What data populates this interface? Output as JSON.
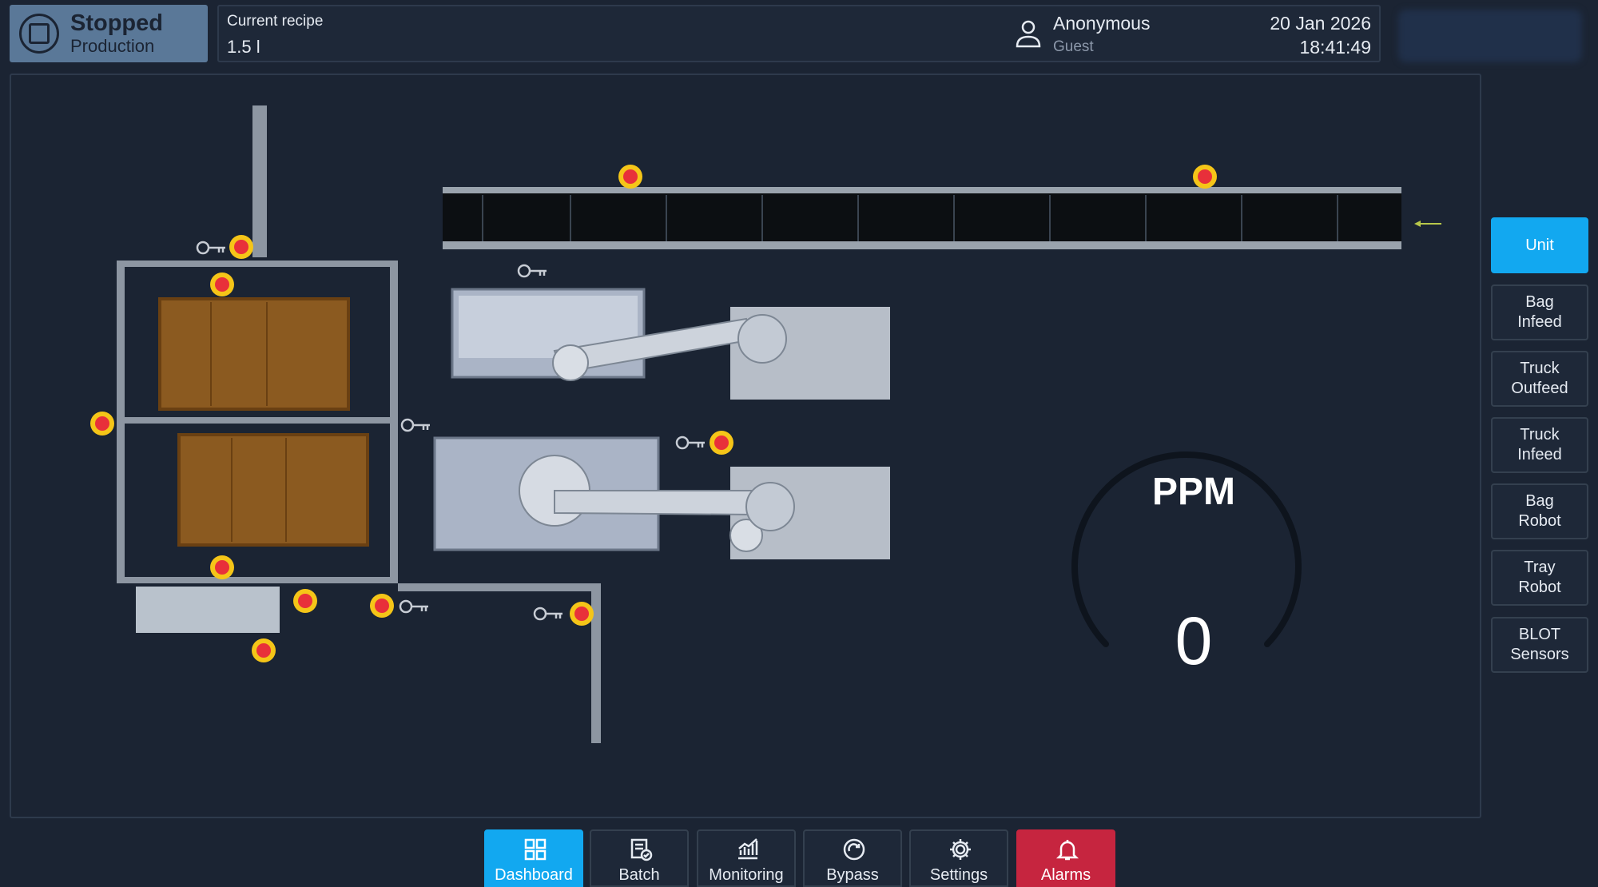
{
  "status": {
    "title": "Stopped",
    "subtitle": "Production"
  },
  "recipe": {
    "label": "Current recipe",
    "value": "1.5 l"
  },
  "user": {
    "name": "Anonymous",
    "role": "Guest",
    "icon": "user-icon"
  },
  "datetime": {
    "date": "20 Jan 2026",
    "time": "18:41:49"
  },
  "gauge": {
    "label": "PPM",
    "value": "0"
  },
  "side_nav": [
    {
      "label": "Unit",
      "active": true
    },
    {
      "label": "Bag\nInfeed",
      "active": false
    },
    {
      "label": "Truck\nOutfeed",
      "active": false
    },
    {
      "label": "Truck\nInfeed",
      "active": false
    },
    {
      "label": "Bag\nRobot",
      "active": false
    },
    {
      "label": "Tray\nRobot",
      "active": false
    },
    {
      "label": "BLOT\nSensors",
      "active": false
    }
  ],
  "bottom_nav": [
    {
      "label": "Dashboard",
      "icon": "dashboard-icon",
      "active": true
    },
    {
      "label": "Batch",
      "icon": "batch-icon",
      "active": false
    },
    {
      "label": "Monitoring",
      "icon": "monitoring-icon",
      "active": false
    },
    {
      "label": "Bypass",
      "icon": "bypass-icon",
      "active": false
    },
    {
      "label": "Settings",
      "icon": "gear-icon",
      "active": false
    },
    {
      "label": "Alarms",
      "icon": "bell-icon",
      "active": false
    }
  ],
  "colors": {
    "background": "#1b2433",
    "status_panel": "#5a7898",
    "accent": "#12a8f0",
    "alarm": "#c6253f",
    "estop_ring": "#f5c518",
    "estop_core": "#e8303a"
  }
}
